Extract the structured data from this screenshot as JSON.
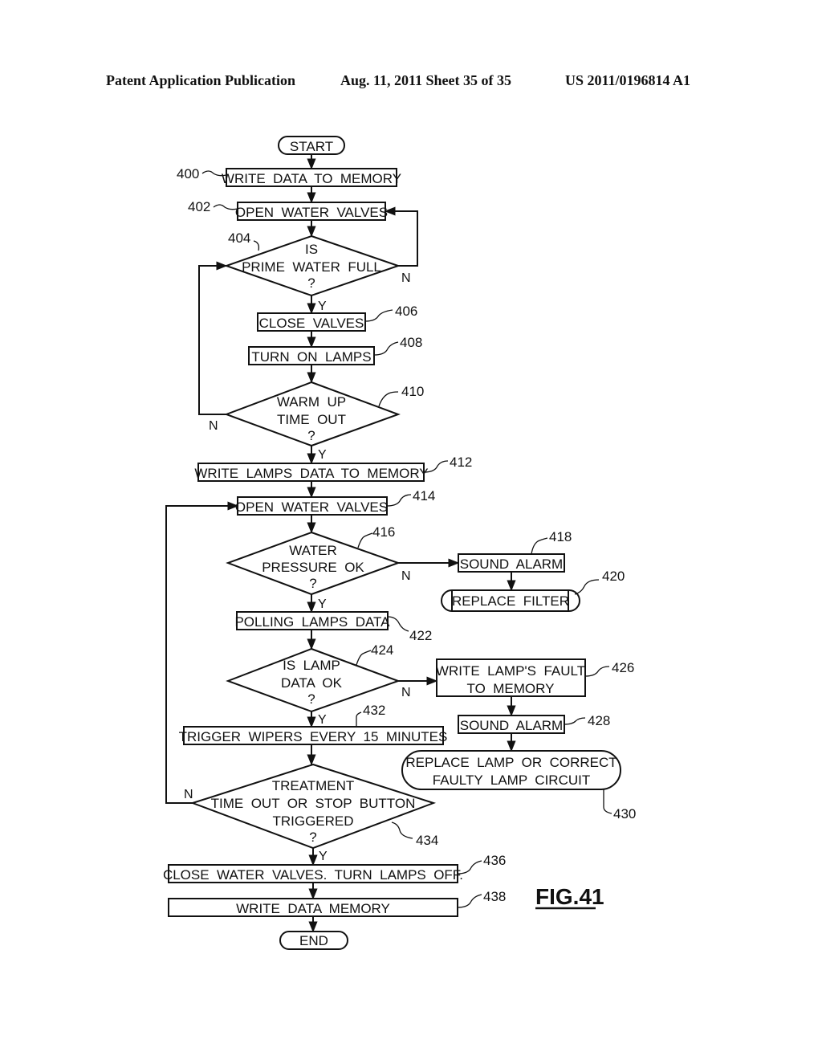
{
  "header": {
    "publication": "Patent Application Publication",
    "date_sheet": "Aug. 11, 2011  Sheet 35 of 35",
    "number": "US 2011/0196814 A1"
  },
  "figure_label": "FIG.41",
  "terminals": {
    "start": "START",
    "end": "END"
  },
  "nodes": {
    "n400": {
      "ref": "400",
      "lines": [
        "WRITE  DATA  TO  MEMORY"
      ]
    },
    "n402": {
      "ref": "402",
      "lines": [
        "OPEN  WATER  VALVES"
      ]
    },
    "n404": {
      "ref": "404",
      "lines": [
        "IS",
        "PRIME  WATER  FULL",
        "?"
      ]
    },
    "n406": {
      "ref": "406",
      "lines": [
        "CLOSE  VALVES"
      ]
    },
    "n408": {
      "ref": "408",
      "lines": [
        "TURN  ON  LAMPS"
      ]
    },
    "n410": {
      "ref": "410",
      "lines": [
        "WARM  UP",
        "TIME  OUT",
        "?"
      ]
    },
    "n412": {
      "ref": "412",
      "lines": [
        "WRITE  LAMPS  DATA  TO  MEMORY"
      ]
    },
    "n414": {
      "ref": "414",
      "lines": [
        "OPEN  WATER  VALVES"
      ]
    },
    "n416": {
      "ref": "416",
      "lines": [
        "WATER",
        "PRESSURE  OK",
        "?"
      ]
    },
    "n418": {
      "ref": "418",
      "lines": [
        "SOUND  ALARM"
      ]
    },
    "n420": {
      "ref": "420",
      "lines": [
        "REPLACE  FILTER"
      ]
    },
    "n422": {
      "ref": "422",
      "lines": [
        "POLLING  LAMPS  DATA"
      ]
    },
    "n424": {
      "ref": "424",
      "lines": [
        "IS  LAMP",
        "DATA  OK",
        "?"
      ]
    },
    "n426": {
      "ref": "426",
      "lines": [
        "WRITE  LAMP'S  FAULT",
        "TO  MEMORY"
      ]
    },
    "n428": {
      "ref": "428",
      "lines": [
        "SOUND  ALARM"
      ]
    },
    "n430": {
      "ref": "430",
      "lines": [
        "REPLACE  LAMP  OR  CORRECT",
        "FAULTY  LAMP  CIRCUIT"
      ]
    },
    "n432": {
      "ref": "432",
      "lines": [
        "TRIGGER  WIPERS  EVERY  15  MINUTES"
      ]
    },
    "n434": {
      "ref": "434",
      "lines": [
        "TREATMENT",
        "TIME  OUT  OR  STOP  BUTTON",
        "TRIGGERED",
        "?"
      ]
    },
    "n436": {
      "ref": "436",
      "lines": [
        "CLOSE  WATER  VALVES.  TURN  LAMPS  OFF."
      ]
    },
    "n438": {
      "ref": "438",
      "lines": [
        "WRITE  DATA  MEMORY"
      ]
    }
  },
  "branch_labels": {
    "yes": "Y",
    "no": "N"
  }
}
